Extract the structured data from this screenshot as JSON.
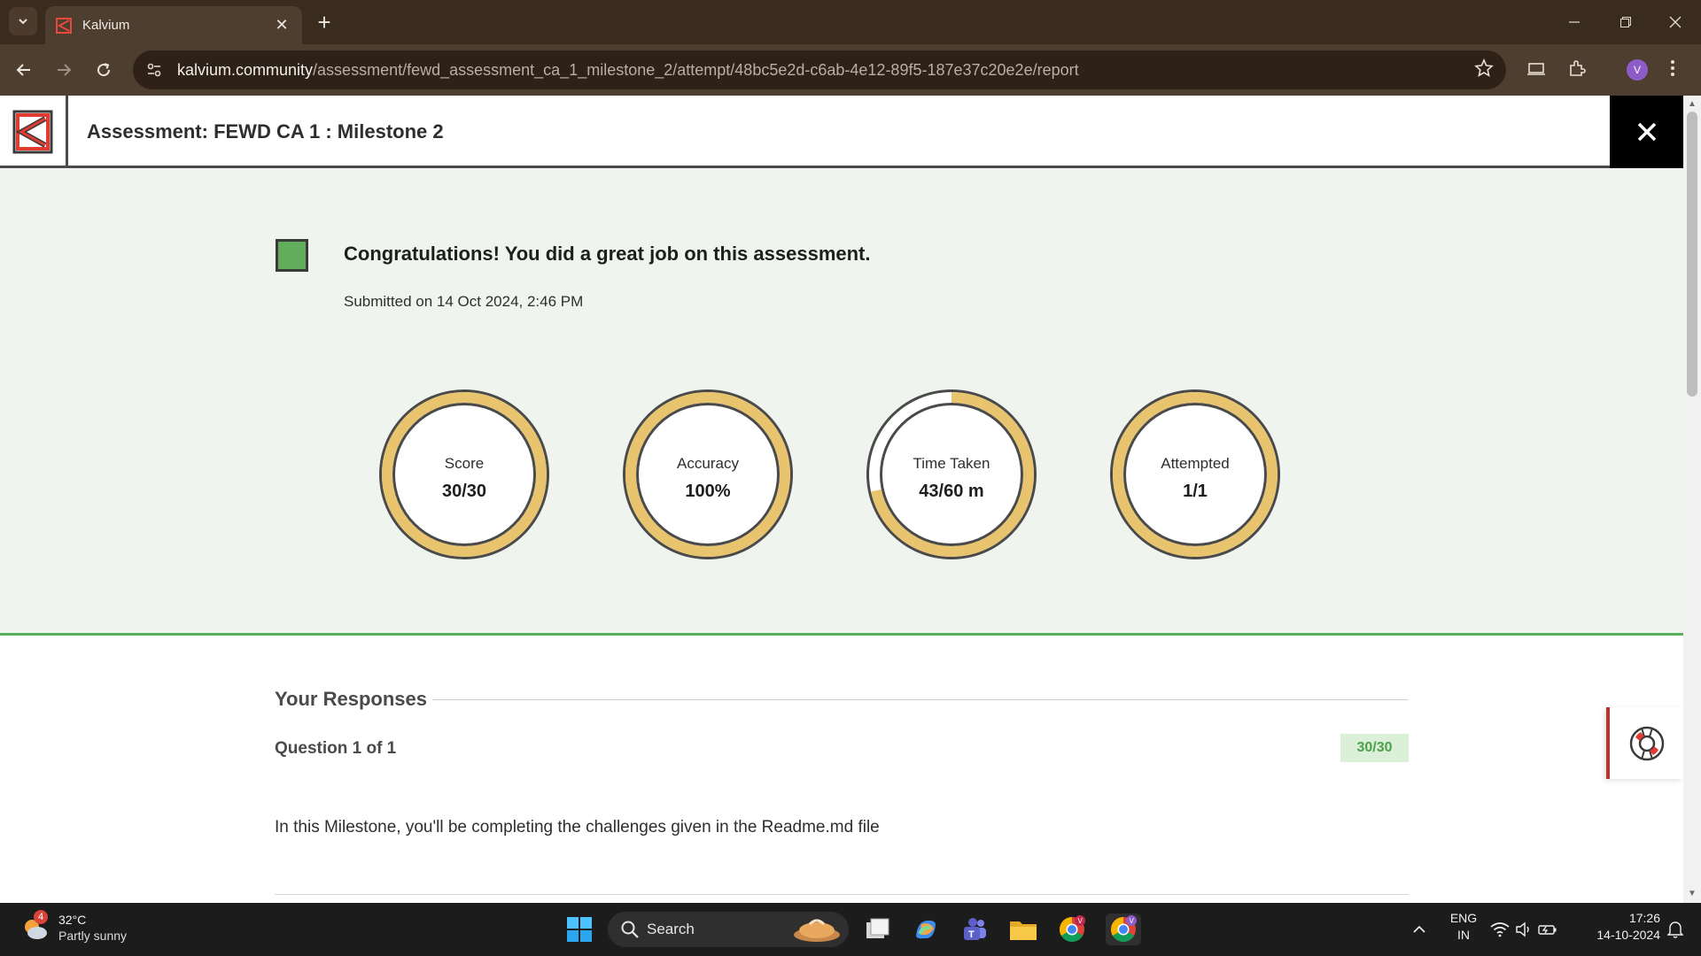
{
  "browser": {
    "tab_title": "Kalvium",
    "url_host": "kalvium.community",
    "url_path": "/assessment/fewd_assessment_ca_1_milestone_2/attempt/48bc5e2d-c6ab-4e12-89f5-187e37c20e2e/report",
    "profile_initial": "V"
  },
  "header": {
    "title": "Assessment: FEWD CA 1 : Milestone 2"
  },
  "hero": {
    "message": "Congratulations! You did a great job on this assessment.",
    "submitted": "Submitted on 14 Oct 2024, 2:46 PM",
    "stats": [
      {
        "label": "Score",
        "value": "30/30",
        "fraction": 1.0
      },
      {
        "label": "Accuracy",
        "value": "100%",
        "fraction": 1.0
      },
      {
        "label": "Time Taken",
        "value": "43/60 m",
        "fraction": 0.7167
      },
      {
        "label": "Attempted",
        "value": "1/1",
        "fraction": 1.0
      }
    ]
  },
  "responses": {
    "title": "Your Responses",
    "question_label": "Question 1 of 1",
    "question_score": "30/30",
    "question_text": "In this Milestone, you'll be completing the challenges given in the Readme.md file"
  },
  "taskbar": {
    "weather_badge": "4",
    "temperature": "32°C",
    "condition": "Partly sunny",
    "search_label": "Search",
    "language": "ENG",
    "region": "IN",
    "time": "17:26",
    "date": "14-10-2024"
  },
  "colors": {
    "ring_fill": "#e9c46f",
    "ring_border": "#4a4a4a",
    "ring_track": "#ffffff",
    "hero_bg": "#eff5ee",
    "accent_green": "#5ab15b"
  }
}
